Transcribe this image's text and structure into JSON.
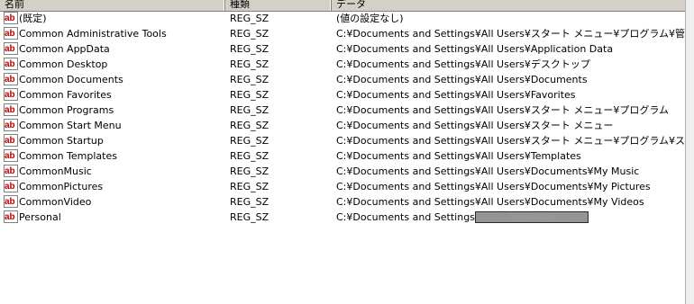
{
  "columns": {
    "name": "名前",
    "type": "種類",
    "data": "データ"
  },
  "rows": [
    {
      "name": "(既定)",
      "type": "REG_SZ",
      "data": "(値の設定なし)"
    },
    {
      "name": "Common Administrative Tools",
      "type": "REG_SZ",
      "data": "C:¥Documents and Settings¥All Users¥スタート メニュー¥プログラム¥管理ツール"
    },
    {
      "name": "Common AppData",
      "type": "REG_SZ",
      "data": "C:¥Documents and Settings¥All Users¥Application Data"
    },
    {
      "name": "Common Desktop",
      "type": "REG_SZ",
      "data": "C:¥Documents and Settings¥All Users¥デスクトップ"
    },
    {
      "name": "Common Documents",
      "type": "REG_SZ",
      "data": "C:¥Documents and Settings¥All Users¥Documents"
    },
    {
      "name": "Common Favorites",
      "type": "REG_SZ",
      "data": "C:¥Documents and Settings¥All Users¥Favorites"
    },
    {
      "name": "Common Programs",
      "type": "REG_SZ",
      "data": "C:¥Documents and Settings¥All Users¥スタート メニュー¥プログラム"
    },
    {
      "name": "Common Start Menu",
      "type": "REG_SZ",
      "data": "C:¥Documents and Settings¥All Users¥スタート メニュー"
    },
    {
      "name": "Common Startup",
      "type": "REG_SZ",
      "data": "C:¥Documents and Settings¥All Users¥スタート メニュー¥プログラム¥スタートアップ"
    },
    {
      "name": "Common Templates",
      "type": "REG_SZ",
      "data": "C:¥Documents and Settings¥All Users¥Templates"
    },
    {
      "name": "CommonMusic",
      "type": "REG_SZ",
      "data": "C:¥Documents and Settings¥All Users¥Documents¥My Music"
    },
    {
      "name": "CommonPictures",
      "type": "REG_SZ",
      "data": "C:¥Documents and Settings¥All Users¥Documents¥My Pictures"
    },
    {
      "name": "CommonVideo",
      "type": "REG_SZ",
      "data": "C:¥Documents and Settings¥All Users¥Documents¥My Videos"
    },
    {
      "name": "Personal",
      "type": "REG_SZ",
      "data": "C:¥Documents and Settings",
      "redacted": true
    }
  ],
  "icon": "registry-string-value-icon",
  "colors": {
    "icon_red": "#c00000",
    "header_bg": "#d4d0c8"
  }
}
